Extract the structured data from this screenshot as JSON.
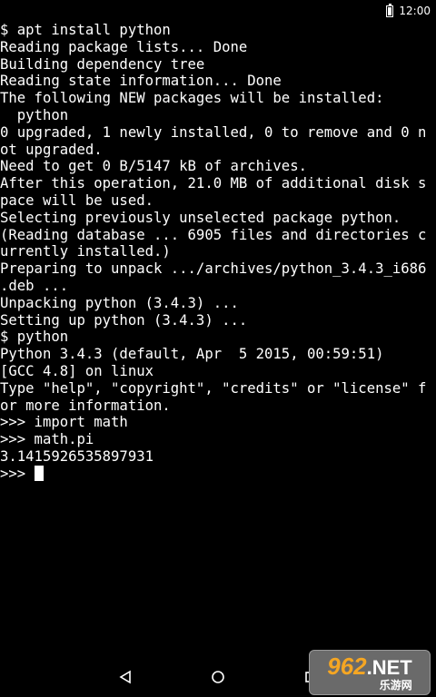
{
  "status_bar": {
    "time": "12:00",
    "battery_level": 1.0
  },
  "terminal": {
    "lines": [
      "$ apt install python",
      "Reading package lists... Done",
      "Building dependency tree",
      "Reading state information... Done",
      "The following NEW packages will be installed:",
      "  python",
      "0 upgraded, 1 newly installed, 0 to remove and 0 n",
      "ot upgraded.",
      "Need to get 0 B/5147 kB of archives.",
      "After this operation, 21.0 MB of additional disk s",
      "pace will be used.",
      "Selecting previously unselected package python.",
      "(Reading database ... 6905 files and directories c",
      "urrently installed.)",
      "Preparing to unpack .../archives/python_3.4.3_i686",
      ".deb ...",
      "Unpacking python (3.4.3) ...",
      "Setting up python (3.4.3) ...",
      "$ python",
      "Python 3.4.3 (default, Apr  5 2015, 00:59:51)",
      "[GCC 4.8] on linux",
      "Type \"help\", \"copyright\", \"credits\" or \"license\" f",
      "or more information.",
      ">>> import math",
      ">>> math.pi",
      "3.1415926535897931"
    ],
    "prompt": ">>> "
  },
  "nav_bar": {
    "back_icon": "back-triangle-icon",
    "home_icon": "home-circle-icon",
    "recents_icon": "recents-square-icon"
  },
  "watermark": {
    "brand": "962",
    "suffix": ".NET",
    "subtitle": "乐游网",
    "color_brand": "#f5a623"
  }
}
